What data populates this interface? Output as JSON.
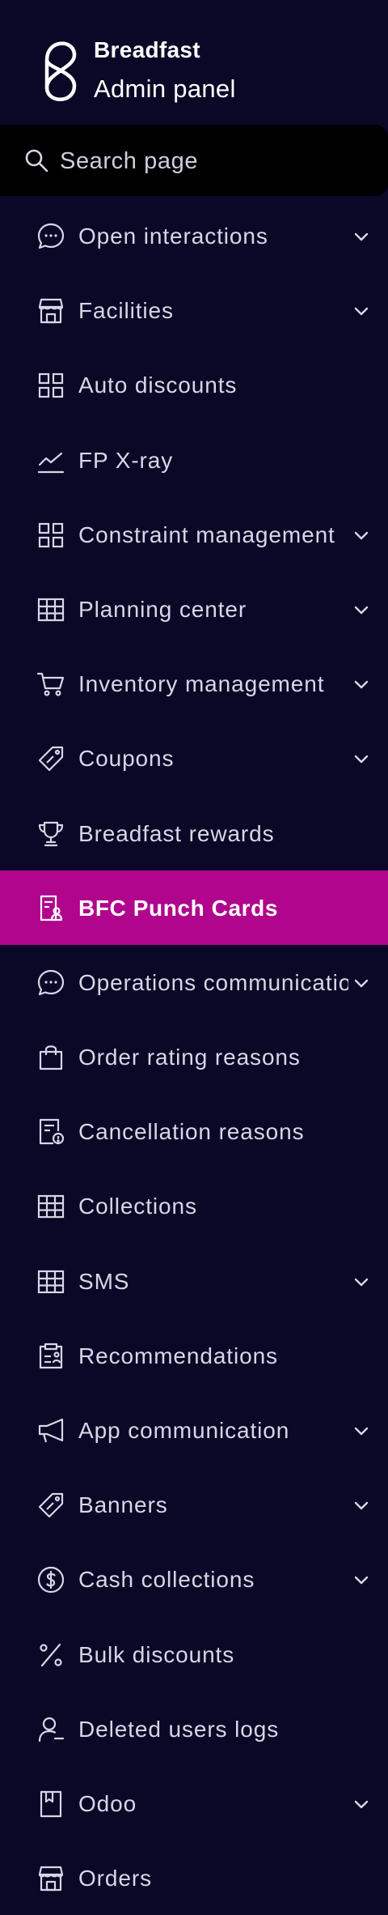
{
  "brand": {
    "name": "Breadfast",
    "subtitle": "Admin panel",
    "logo_icon": "breadfast-logo-icon"
  },
  "search": {
    "placeholder": "Search page",
    "value": "",
    "icon": "search-icon"
  },
  "colors": {
    "background": "#0a0826",
    "search_background": "#000000",
    "active_item": "#b0058c",
    "text": "#d8d6e6"
  },
  "nav": {
    "items": [
      {
        "label": "Open interactions",
        "icon": "chat-bubble-icon",
        "expandable": true,
        "active": false
      },
      {
        "label": "Facilities",
        "icon": "store-icon",
        "expandable": true,
        "active": false
      },
      {
        "label": "Auto discounts",
        "icon": "grid-icon",
        "expandable": false,
        "active": false
      },
      {
        "label": "FP X-ray",
        "icon": "line-chart-icon",
        "expandable": false,
        "active": false
      },
      {
        "label": "Constraint management",
        "icon": "grid-icon",
        "expandable": true,
        "active": false
      },
      {
        "label": "Planning center",
        "icon": "table-icon",
        "expandable": true,
        "active": false
      },
      {
        "label": "Inventory management",
        "icon": "cart-icon",
        "expandable": true,
        "active": false
      },
      {
        "label": "Coupons",
        "icon": "tag-icon",
        "expandable": true,
        "active": false
      },
      {
        "label": "Breadfast rewards",
        "icon": "trophy-icon",
        "expandable": false,
        "active": false
      },
      {
        "label": "BFC Punch Cards",
        "icon": "punch-card-icon",
        "expandable": false,
        "active": true
      },
      {
        "label": "Operations communications",
        "icon": "chat-bubble-icon",
        "expandable": true,
        "active": false
      },
      {
        "label": "Order rating reasons",
        "icon": "shopping-bag-icon",
        "expandable": false,
        "active": false
      },
      {
        "label": "Cancellation reasons",
        "icon": "receipt-alert-icon",
        "expandable": false,
        "active": false
      },
      {
        "label": "Collections",
        "icon": "table-icon",
        "expandable": false,
        "active": false
      },
      {
        "label": "SMS",
        "icon": "table-icon",
        "expandable": true,
        "active": false
      },
      {
        "label": "Recommendations",
        "icon": "clipboard-icon",
        "expandable": false,
        "active": false
      },
      {
        "label": "App communication",
        "icon": "megaphone-icon",
        "expandable": true,
        "active": false
      },
      {
        "label": "Banners",
        "icon": "tag-icon",
        "expandable": true,
        "active": false
      },
      {
        "label": "Cash collections",
        "icon": "dollar-circle-icon",
        "expandable": true,
        "active": false
      },
      {
        "label": "Bulk discounts",
        "icon": "percent-icon",
        "expandable": false,
        "active": false
      },
      {
        "label": "Deleted users logs",
        "icon": "user-minus-icon",
        "expandable": false,
        "active": false
      },
      {
        "label": "Odoo",
        "icon": "book-icon",
        "expandable": true,
        "active": false
      },
      {
        "label": "Orders",
        "icon": "store-icon",
        "expandable": false,
        "active": false
      }
    ]
  }
}
